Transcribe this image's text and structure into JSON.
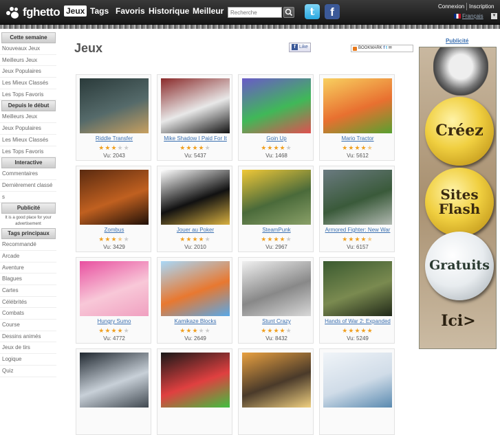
{
  "header": {
    "logo_text": "fghetto",
    "nav": [
      "Jeux",
      "Tags",
      "Favoris",
      "Historique",
      "Meilleur"
    ],
    "search_placeholder": "Recherche",
    "connexion": "Connexion",
    "inscription": "Inscription",
    "language": "Français"
  },
  "sidebar": {
    "cette_semaine": "Cette semaine",
    "cette_semaine_items": [
      "Nouveaux Jeux",
      "Meilleurs Jeux",
      "Jeux Populaires",
      "Les Mieux Classés",
      "Les Tops Favoris"
    ],
    "depuis_debut": "Depuis le début",
    "depuis_debut_items": [
      "Meilleurs Jeux",
      "Jeux Populaires",
      "Les Mieux Classés",
      "Les Tops Favoris"
    ],
    "interactive": "Interactive",
    "interactive_items": [
      "Commentaires",
      "Dernièrement classé",
      "s"
    ],
    "publicite": "Publicité",
    "ad_text": "It is a good place for your advertisement",
    "tags_principaux": "Tags principaux",
    "tags": [
      "Recommandé",
      "Arcade",
      "Aventure",
      "Blagues",
      "Cartes",
      "Célébrités",
      "Combats",
      "Course",
      "Dessins animés",
      "Jeux de tirs",
      "Logique",
      "Quiz"
    ]
  },
  "main": {
    "title": "Jeux",
    "like_label": "Like",
    "bookmark_label": "BOOKMARK",
    "games": [
      {
        "name": "Riddle Transfer",
        "rating": 3,
        "views": "Vu: 2043",
        "colors": [
          "#2a3a3a",
          "#556a6a",
          "#c8a060"
        ]
      },
      {
        "name": "Mike Shadow I Paid For It",
        "rating": 4,
        "views": "Vu: 5437",
        "colors": [
          "#8a2a2a",
          "#e8e8e8",
          "#111111"
        ]
      },
      {
        "name": "Goin Up",
        "rating": 4,
        "views": "Vu: 1468",
        "colors": [
          "#6a5ac8",
          "#40b858",
          "#e05050"
        ]
      },
      {
        "name": "Mario Tractor",
        "rating": 4.5,
        "views": "Vu: 5612",
        "colors": [
          "#f8d060",
          "#e87030",
          "#58a030"
        ]
      },
      {
        "name": "Zombus",
        "rating": 3.5,
        "views": "Vu: 3429",
        "colors": [
          "#5a2a10",
          "#c06020",
          "#201008"
        ]
      },
      {
        "name": "Jouer au Poker",
        "rating": 4,
        "views": "Vu: 2010",
        "colors": [
          "#ffffff",
          "#111111",
          "#d8b040"
        ]
      },
      {
        "name": "SteamPunk",
        "rating": 4,
        "views": "Vu: 2967",
        "colors": [
          "#f0c838",
          "#4a6a3a",
          "#8aa068"
        ]
      },
      {
        "name": "Armored Fighter: New War",
        "rating": 4.5,
        "views": "Vu: 6157",
        "colors": [
          "#6a7a80",
          "#3a5a3a",
          "#b0b8b0"
        ]
      },
      {
        "name": "Hungry Sumo",
        "rating": 4,
        "views": "Vu: 4772",
        "colors": [
          "#e850a0",
          "#f8c8d8",
          "#f0a0c0"
        ]
      },
      {
        "name": "Kamikaze Blocks",
        "rating": 3,
        "views": "Vu: 2649",
        "colors": [
          "#a8d8f8",
          "#e87830",
          "#58a8e8"
        ]
      },
      {
        "name": "Stunt Crazy",
        "rating": 4,
        "views": "Vu: 8432",
        "colors": [
          "#f0f0f0",
          "#888888",
          "#d8d8d8"
        ]
      },
      {
        "name": "Hands of War 2: Expanded",
        "rating": 5,
        "views": "Vu: 5249",
        "colors": [
          "#3a5a30",
          "#7a8a50",
          "#202818"
        ]
      },
      {
        "name": "",
        "rating": 0,
        "views": "",
        "colors": [
          "#202830",
          "#c8d0d8",
          "#404850"
        ]
      },
      {
        "name": "",
        "rating": 0,
        "views": "",
        "colors": [
          "#181818",
          "#e04040",
          "#40c040"
        ]
      },
      {
        "name": "",
        "rating": 0,
        "views": "",
        "colors": [
          "#e8a040",
          "#4a3a2a",
          "#f0d080"
        ]
      },
      {
        "name": "",
        "rating": 0,
        "views": "",
        "colors": [
          "#f0f4f8",
          "#d0dce8",
          "#5a8ab0"
        ]
      }
    ]
  },
  "right_ad": {
    "label": "Publicité",
    "line1": "Créez",
    "line2a": "Sites",
    "line2b": "Flash",
    "line3": "Gratuits",
    "line4": "Ici>"
  }
}
